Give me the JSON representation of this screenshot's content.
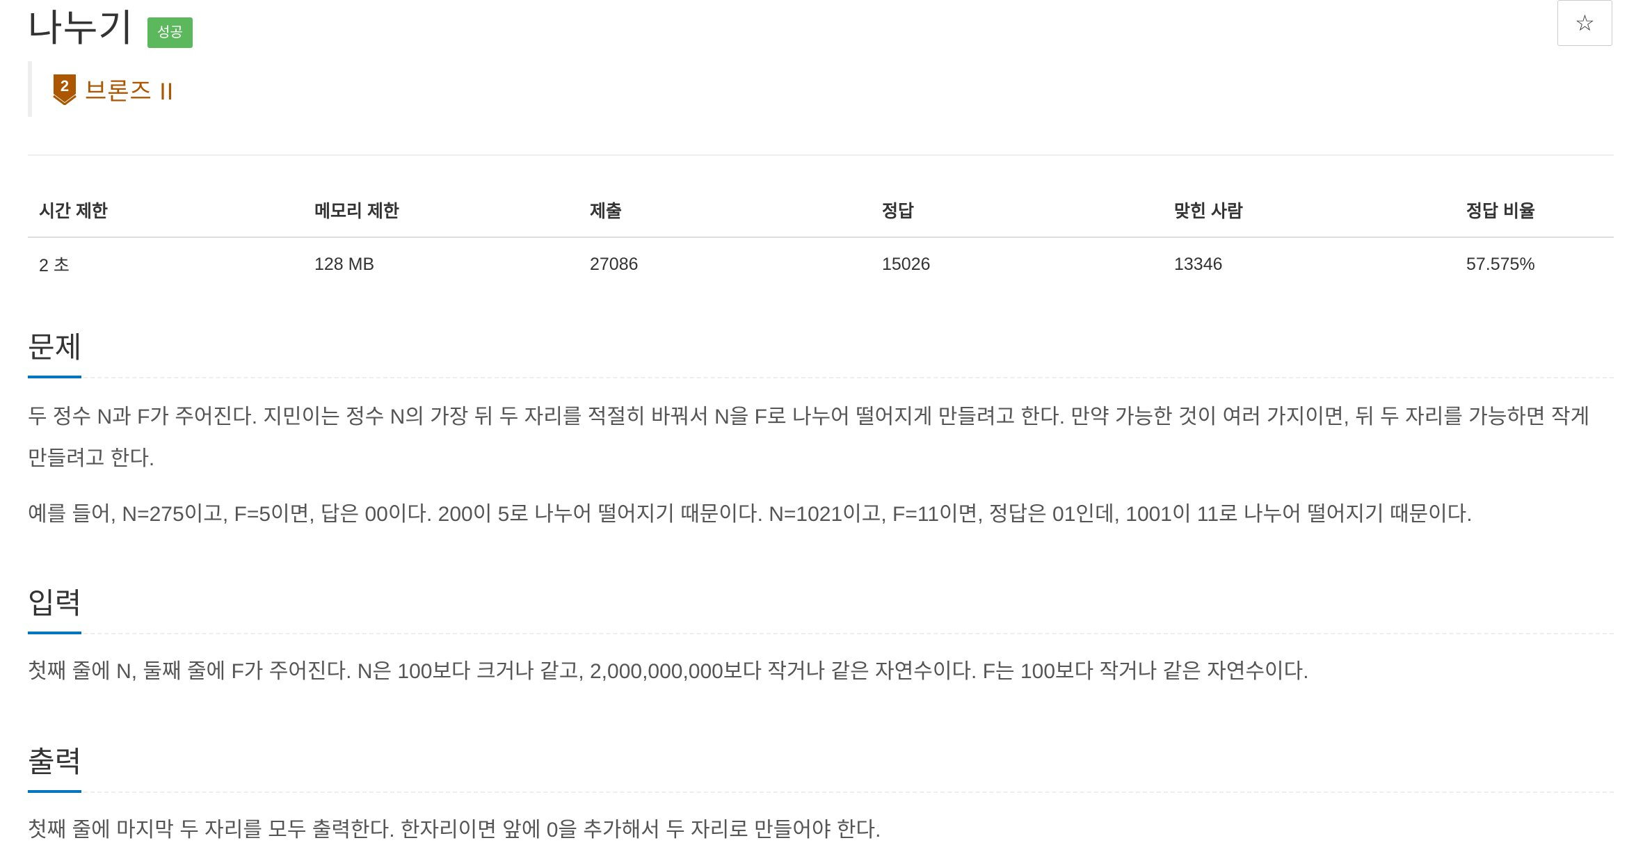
{
  "problem": {
    "title": "나누기",
    "status_badge": "성공",
    "star_icon": "☆",
    "tier": {
      "number": "2",
      "label": "브론즈 II",
      "color": "#ad5600"
    }
  },
  "info_table": {
    "headers": [
      "시간 제한",
      "메모리 제한",
      "제출",
      "정답",
      "맞힌 사람",
      "정답 비율"
    ],
    "values": [
      "2 초",
      "128 MB",
      "27086",
      "15026",
      "13346",
      "57.575%"
    ]
  },
  "sections": {
    "problem": {
      "title": "문제",
      "paragraphs": [
        "두 정수 N과 F가 주어진다. 지민이는 정수 N의 가장 뒤 두 자리를 적절히 바꿔서 N을 F로 나누어 떨어지게 만들려고 한다. 만약 가능한 것이 여러 가지이면, 뒤 두 자리를 가능하면 작게 만들려고 한다.",
        "예를 들어, N=275이고, F=5이면, 답은 00이다. 200이 5로 나누어 떨어지기 때문이다. N=1021이고, F=11이면, 정답은 01인데, 1001이 11로 나누어 떨어지기 때문이다."
      ]
    },
    "input": {
      "title": "입력",
      "paragraphs": [
        "첫째 줄에 N, 둘째 줄에 F가 주어진다. N은 100보다 크거나 같고, 2,000,000,000보다 작거나 같은 자연수이다. F는 100보다 작거나 같은 자연수이다."
      ]
    },
    "output": {
      "title": "출력",
      "paragraphs": [
        "첫째 줄에 마지막 두 자리를 모두 출력한다. 한자리이면 앞에 0을 추가해서 두 자리로 만들어야 한다."
      ]
    }
  },
  "colors": {
    "badge_success": "#5cb85c",
    "section_underline": "#0076c0",
    "tier_bronze": "#ad5600"
  }
}
